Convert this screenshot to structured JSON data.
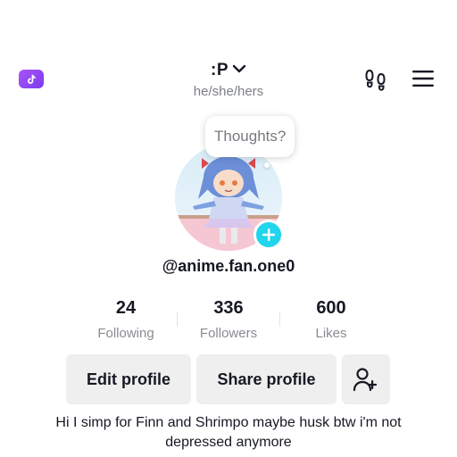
{
  "header": {
    "title": ":P",
    "pronouns": "he/she/hers",
    "app_icon": "tiktok-icon",
    "footprint_icon": "footprints-icon",
    "menu_icon": "hamburger-menu-icon"
  },
  "profile": {
    "thought_bubble": "Thoughts?",
    "username": "@anime.fan.one0"
  },
  "stats": [
    {
      "value": "24",
      "label": "Following"
    },
    {
      "value": "336",
      "label": "Followers"
    },
    {
      "value": "600",
      "label": "Likes"
    }
  ],
  "actions": {
    "edit_label": "Edit profile",
    "share_label": "Share profile",
    "add_friend_icon": "add-friend-icon"
  },
  "bio": "Hi I simp for Finn and Shrimpo maybe husk btw i'm not depressed anymore",
  "colors": {
    "accent": "#20d5ec",
    "badge": "#8b3cf0",
    "button_bg": "#efefef",
    "muted_text": "#8a8b91"
  }
}
